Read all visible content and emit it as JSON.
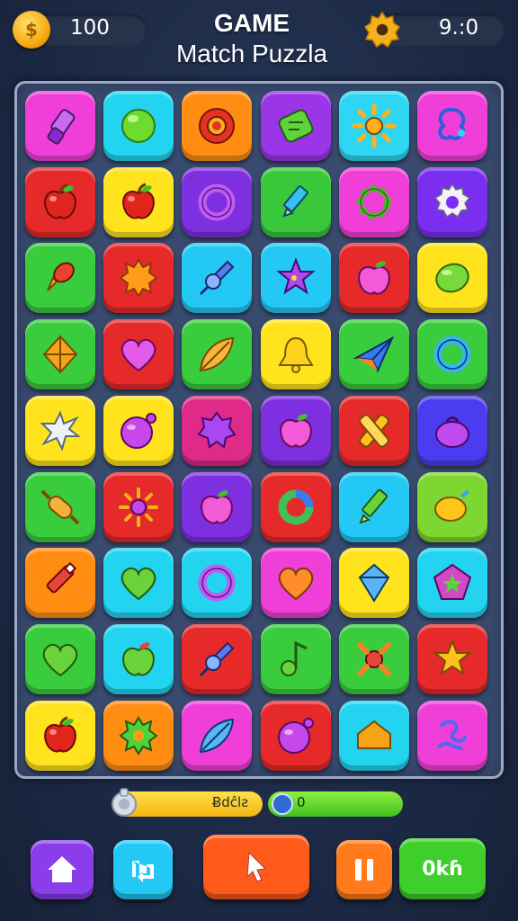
{
  "header": {
    "coins": "100",
    "coin_symbol": "$",
    "title_line1": "GAME",
    "title_line2": "Match Puzzla",
    "timer": "9.:0"
  },
  "board": {
    "rows": 9,
    "cols": 6,
    "tiles": [
      {
        "color": "#ef3fd8",
        "icon": "lipstick-icon"
      },
      {
        "color": "#23d4f0",
        "icon": "green-ball-icon"
      },
      {
        "color": "#ff8d12",
        "icon": "red-button-icon"
      },
      {
        "color": "#9b35e8",
        "icon": "green-scroll-icon"
      },
      {
        "color": "#2fd6f3",
        "icon": "sun-icon"
      },
      {
        "color": "#ef3fd8",
        "icon": "blue-star-swirl-icon"
      },
      {
        "color": "#e62a2a",
        "icon": "apple-icon"
      },
      {
        "color": "#ffe31c",
        "icon": "apple-icon"
      },
      {
        "color": "#7e2fe0",
        "icon": "purple-ring-icon"
      },
      {
        "color": "#38c83a",
        "icon": "pencil-icon"
      },
      {
        "color": "#ef3fd8",
        "icon": "green-wreath-icon"
      },
      {
        "color": "#7a2ff0",
        "icon": "white-gear-icon"
      },
      {
        "color": "#39cc3d",
        "icon": "ice-cream-icon"
      },
      {
        "color": "#e62a2a",
        "icon": "orange-splat-icon"
      },
      {
        "color": "#23c8f5",
        "icon": "blue-pin-icon"
      },
      {
        "color": "#23c8f5",
        "icon": "purple-star-icon"
      },
      {
        "color": "#e62a2a",
        "icon": "pink-apple-icon"
      },
      {
        "color": "#ffe31c",
        "icon": "lime-icon"
      },
      {
        "color": "#39cc3d",
        "icon": "orange-gem-icon"
      },
      {
        "color": "#e62a2a",
        "icon": "heart-icon"
      },
      {
        "color": "#39cc3d",
        "icon": "leaf-icon"
      },
      {
        "color": "#ffe31c",
        "icon": "bell-icon"
      },
      {
        "color": "#39cc3d",
        "icon": "paper-plane-icon"
      },
      {
        "color": "#39cc3d",
        "icon": "blue-ring-icon"
      },
      {
        "color": "#ffe31c",
        "icon": "white-splat-icon"
      },
      {
        "color": "#ffe31c",
        "icon": "purple-ball-icon"
      },
      {
        "color": "#e02a8a",
        "icon": "purple-blob-icon"
      },
      {
        "color": "#7e2fe0",
        "icon": "pink-apple-icon"
      },
      {
        "color": "#e62a2a",
        "icon": "yellow-cross-icon"
      },
      {
        "color": "#4b3cf0",
        "icon": "purple-bag-icon"
      },
      {
        "color": "#39cc3d",
        "icon": "rolling-pin-icon"
      },
      {
        "color": "#e62a2a",
        "icon": "purple-flower-icon"
      },
      {
        "color": "#7e2fe0",
        "icon": "pink-apple-icon"
      },
      {
        "color": "#e62a2a",
        "icon": "green-ring-icon"
      },
      {
        "color": "#23c8f5",
        "icon": "green-pencil-icon"
      },
      {
        "color": "#7ed630",
        "icon": "lemon-icon"
      },
      {
        "color": "#ff8d12",
        "icon": "red-pencil-icon"
      },
      {
        "color": "#23d4f0",
        "icon": "green-heart-icon"
      },
      {
        "color": "#23d4f0",
        "icon": "purple-ring-icon"
      },
      {
        "color": "#ef3fd8",
        "icon": "orange-heart-icon"
      },
      {
        "color": "#ffe31c",
        "icon": "blue-kite-icon"
      },
      {
        "color": "#23d4f0",
        "icon": "pentagon-star-icon"
      },
      {
        "color": "#39cc3d",
        "icon": "green-heart-icon"
      },
      {
        "color": "#23d4f0",
        "icon": "green-apple-icon"
      },
      {
        "color": "#e62a2a",
        "icon": "blue-pin-icon"
      },
      {
        "color": "#39cc3d",
        "icon": "music-note-icon"
      },
      {
        "color": "#39cc3d",
        "icon": "red-cross-icon"
      },
      {
        "color": "#e62a2a",
        "icon": "star-icon"
      },
      {
        "color": "#ffe31c",
        "icon": "apple-icon"
      },
      {
        "color": "#ff8d12",
        "icon": "green-splat-icon"
      },
      {
        "color": "#ef3fd8",
        "icon": "blue-leaf-icon"
      },
      {
        "color": "#e62a2a",
        "icon": "purple-ball-icon"
      },
      {
        "color": "#23d4f0",
        "icon": "orange-house-icon"
      },
      {
        "color": "#ef3fd8",
        "icon": "blue-swirl-icon"
      }
    ]
  },
  "progress": {
    "left_label": "Ƀdĉlƨ",
    "left_fraction": 1.0,
    "right_label": "0",
    "right_fraction": 1.0
  },
  "footer": {
    "home_color": "#8a3de8",
    "shuffle_color": "#23c8f5",
    "play_color": "#ff5a1a",
    "pause_color": "#ff7a1a",
    "ok_color": "#3fcf2a",
    "ok_label": "0kɦ"
  }
}
